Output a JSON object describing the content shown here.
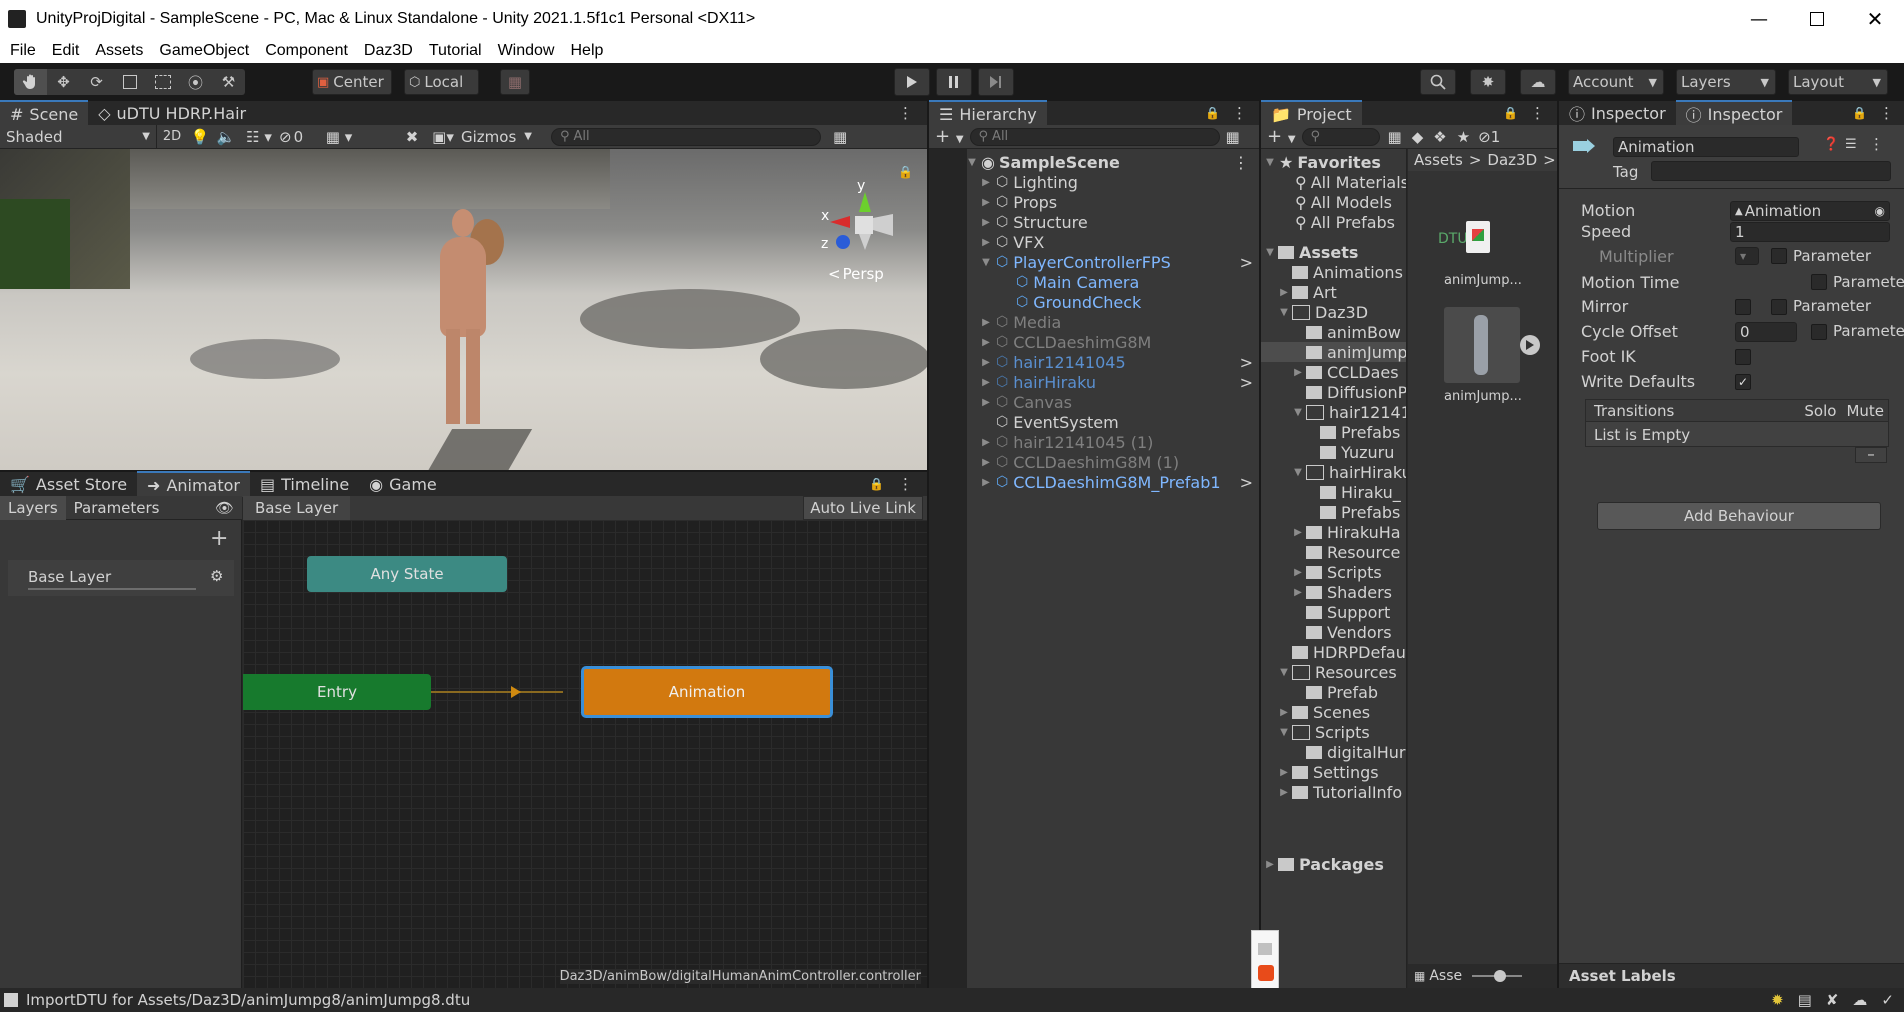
{
  "window": {
    "title": "UnityProjDigital - SampleScene - PC, Mac & Linux Standalone - Unity 2021.1.5f1c1 Personal <DX11>"
  },
  "menu": [
    "File",
    "Edit",
    "Assets",
    "GameObject",
    "Component",
    "Daz3D",
    "Tutorial",
    "Window",
    "Help"
  ],
  "toolbar": {
    "pivot_center": "Center",
    "pivot_local": "Local",
    "account": "Account",
    "layers": "Layers",
    "layout": "Layout"
  },
  "scene_panel": {
    "tabs": [
      "Scene",
      "uDTU HDRP.Hair"
    ],
    "shading_mode": "Shaded",
    "mode_2d": "2D",
    "hidden_count": "0",
    "gizmos": "Gizmos",
    "search_placeholder": "All",
    "persp_label": "Persp",
    "axis_y": "y",
    "axis_x": "x",
    "axis_z": "z"
  },
  "animator_panel": {
    "tabs": [
      "Asset Store",
      "Animator",
      "Timeline",
      "Game"
    ],
    "layers_tab": "Layers",
    "parameters_tab": "Parameters",
    "breadcrumb": "Base Layer",
    "auto_live_link": "Auto Live Link",
    "base_layer": "Base Layer",
    "nodes": {
      "any_state": "Any State",
      "entry": "Entry",
      "animation": "Animation"
    },
    "footer_path": "Daz3D/animBow/digitalHumanAnimController.controller"
  },
  "hierarchy": {
    "title": "Hierarchy",
    "search_placeholder": "All",
    "scene": "SampleScene",
    "items": [
      {
        "label": "Lighting",
        "style": "normal",
        "depth": 1
      },
      {
        "label": "Props",
        "style": "normal",
        "depth": 1
      },
      {
        "label": "Structure",
        "style": "normal",
        "depth": 1
      },
      {
        "label": "VFX",
        "style": "normal",
        "depth": 1
      },
      {
        "label": "PlayerControllerFPS",
        "style": "blue",
        "depth": 1
      },
      {
        "label": "Main Camera",
        "style": "blue",
        "depth": 2
      },
      {
        "label": "GroundCheck",
        "style": "blue",
        "depth": 2
      },
      {
        "label": "Media",
        "style": "dim",
        "depth": 1
      },
      {
        "label": "CCLDaeshimG8M",
        "style": "dim",
        "depth": 1
      },
      {
        "label": "hair12141045",
        "style": "blue-dim",
        "depth": 1
      },
      {
        "label": "hairHiraku",
        "style": "blue-dim",
        "depth": 1
      },
      {
        "label": "Canvas",
        "style": "dim",
        "depth": 1
      },
      {
        "label": "EventSystem",
        "style": "normal",
        "depth": 1
      },
      {
        "label": "hair12141045 (1)",
        "style": "dim",
        "depth": 1
      },
      {
        "label": "CCLDaeshimG8M (1)",
        "style": "dim",
        "depth": 1
      },
      {
        "label": "CCLDaeshimG8M_Prefab1",
        "style": "blue",
        "depth": 1
      }
    ]
  },
  "project": {
    "title": "Project",
    "hidden_count": "1",
    "favorites": "Favorites",
    "favorite_items": [
      "All Materials",
      "All Models",
      "All Prefabs"
    ],
    "assets": "Assets",
    "tree": [
      {
        "label": "Animations",
        "depth": 1
      },
      {
        "label": "Art",
        "depth": 1
      },
      {
        "label": "Daz3D",
        "depth": 1
      },
      {
        "label": "animBow",
        "depth": 2
      },
      {
        "label": "animJump",
        "depth": 2
      },
      {
        "label": "CCLDaes",
        "depth": 2
      },
      {
        "label": "DiffusionP",
        "depth": 2
      },
      {
        "label": "hair12141",
        "depth": 2
      },
      {
        "label": "Prefabs",
        "depth": 3
      },
      {
        "label": "Yuzuru",
        "depth": 3
      },
      {
        "label": "hairHiraku",
        "depth": 2
      },
      {
        "label": "Hiraku_",
        "depth": 3
      },
      {
        "label": "Prefabs",
        "depth": 3
      },
      {
        "label": "HirakuHa",
        "depth": 2
      },
      {
        "label": "Resource",
        "depth": 2
      },
      {
        "label": "Scripts",
        "depth": 2
      },
      {
        "label": "Shaders",
        "depth": 2
      },
      {
        "label": "Support",
        "depth": 2
      },
      {
        "label": "Vendors",
        "depth": 2
      },
      {
        "label": "HDRPDefau",
        "depth": 1
      },
      {
        "label": "Resources",
        "depth": 1
      },
      {
        "label": "Prefab",
        "depth": 2
      },
      {
        "label": "Scenes",
        "depth": 1
      },
      {
        "label": "Scripts",
        "depth": 1
      },
      {
        "label": "digitalHur",
        "depth": 2
      },
      {
        "label": "Settings",
        "depth": 1
      },
      {
        "label": "TutorialInfo",
        "depth": 1
      }
    ],
    "packages": "Packages",
    "breadcrumb": [
      "Assets",
      "Daz3D"
    ],
    "asset_items": [
      {
        "label": "animJump...",
        "badge": "DTU"
      },
      {
        "label": "animJump...",
        "badge": ""
      }
    ],
    "footer_label": "Asse"
  },
  "inspector": {
    "tabs": [
      "Inspector",
      "Inspector"
    ],
    "object_name": "Animation",
    "tag_label": "Tag",
    "fields": {
      "motion_label": "Motion",
      "motion_value": "Animation",
      "speed_label": "Speed",
      "speed_value": "1",
      "multiplier_label": "Multiplier",
      "motion_time_label": "Motion Time",
      "mirror_label": "Mirror",
      "cycle_offset_label": "Cycle Offset",
      "cycle_offset_value": "0",
      "foot_ik_label": "Foot IK",
      "write_defaults_label": "Write Defaults",
      "parameter_label": "Parameter"
    },
    "transitions": {
      "title": "Transitions",
      "solo": "Solo",
      "mute": "Mute",
      "empty": "List is Empty"
    },
    "add_behaviour": "Add Behaviour",
    "asset_labels": "Asset Labels"
  },
  "status": {
    "message": "ImportDTU for Assets/Daz3D/animJumpg8/animJumpg8.dtu"
  },
  "colors": {
    "accent": "#3a79bb",
    "any_state": "#3e8d87",
    "entry": "#1b7a2f",
    "animation": "#d2790f"
  }
}
